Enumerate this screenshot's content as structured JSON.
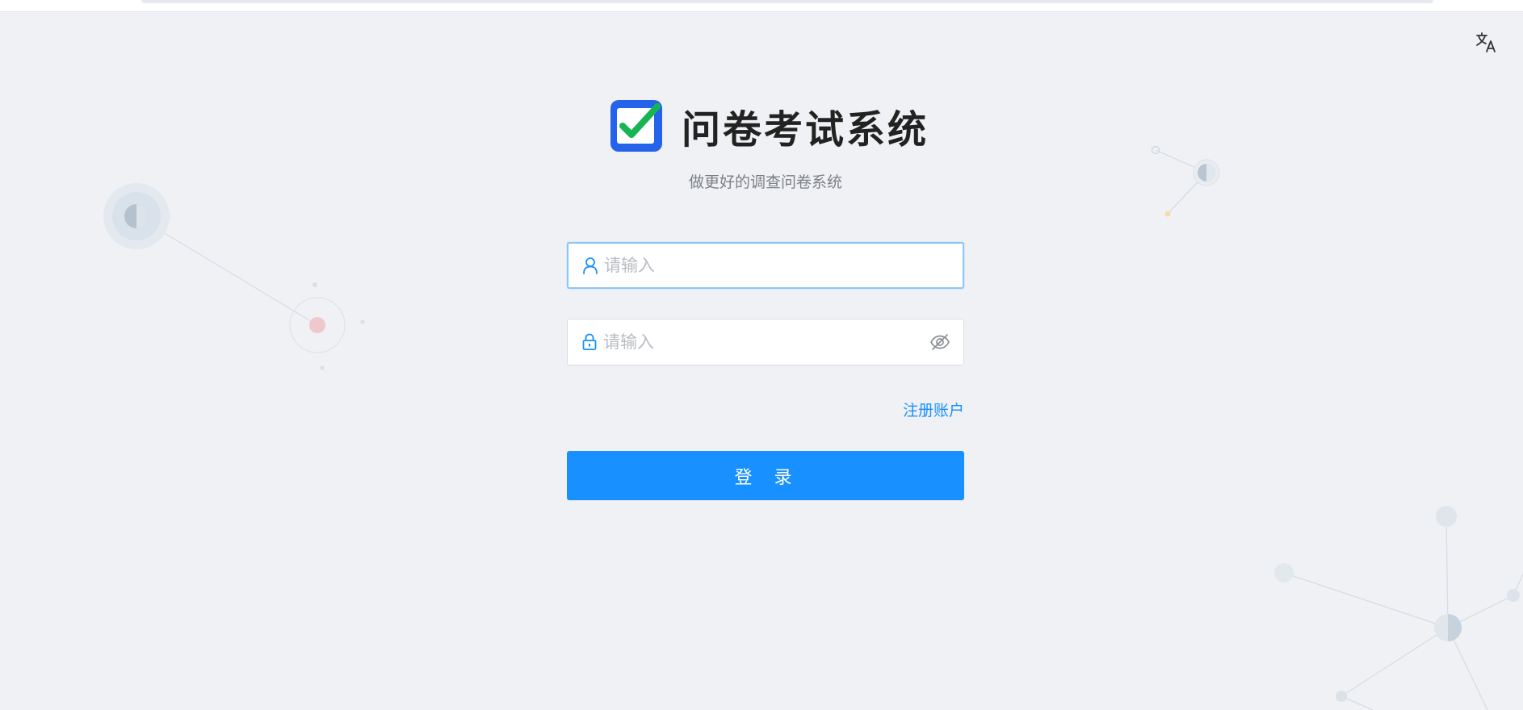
{
  "app": {
    "title": "问卷考试系统",
    "subtitle": "做更好的调查问卷系统"
  },
  "header": {
    "language_icon": "translate-icon"
  },
  "login_form": {
    "username": {
      "icon": "user-icon",
      "placeholder": "请输入",
      "value": ""
    },
    "password": {
      "icon": "lock-icon",
      "placeholder": "请输入",
      "value": "",
      "toggle_icon": "eye-slash-icon"
    },
    "register_link": "注册账户",
    "login_button": "登 录"
  },
  "colors": {
    "primary": "#1890ff",
    "background": "#eff1f5",
    "logo_blue": "#2563eb",
    "logo_check": "#16b552",
    "title_text": "#222222"
  }
}
